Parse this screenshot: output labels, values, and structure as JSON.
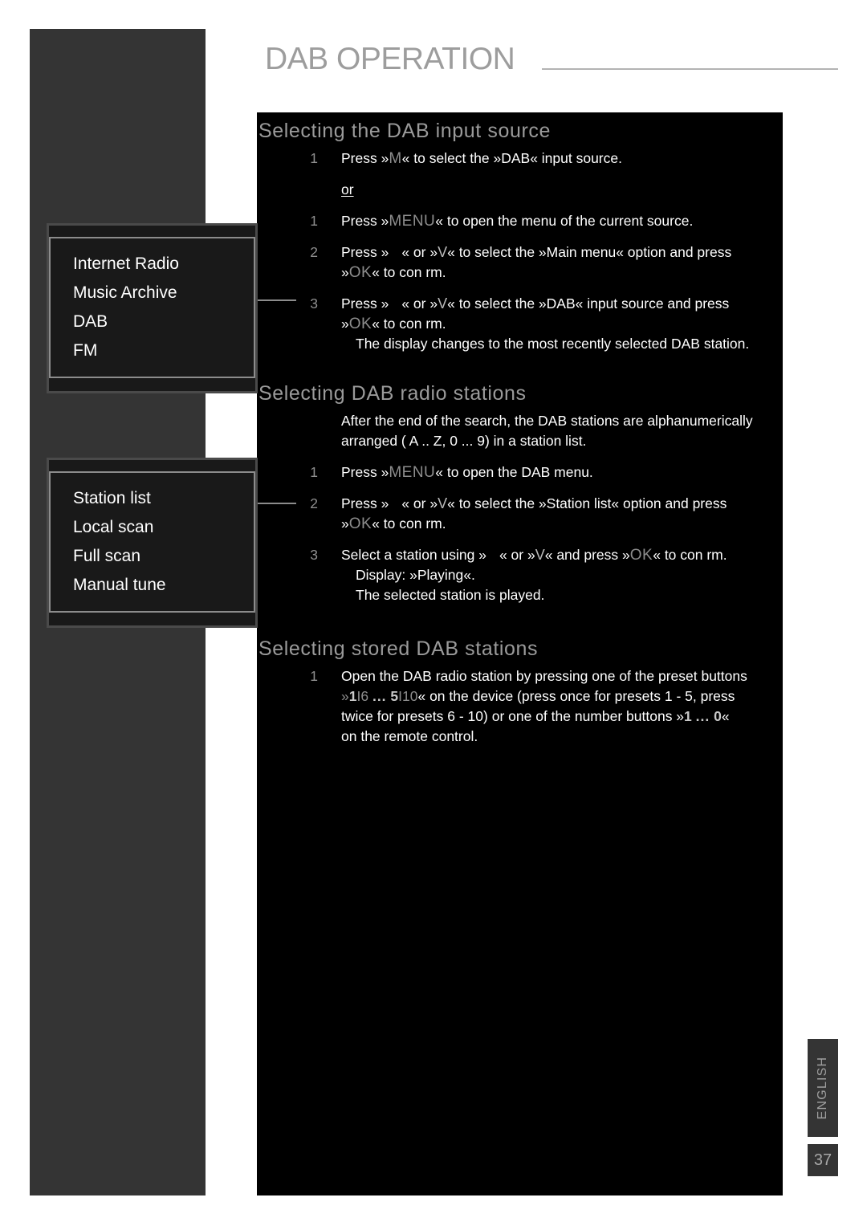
{
  "header": {
    "title": "DAB OPERATION"
  },
  "sections": [
    {
      "id": "selecting-dab-input-source",
      "title": "Selecting the DAB input source",
      "steps": [
        {
          "num": "1",
          "line1_a": "Press »",
          "key": "M",
          "line1_b": "« to select the »DAB« input source."
        }
      ],
      "or_label": "or",
      "steps2": [
        {
          "num": "1",
          "line1_a": "Press »",
          "key": "MENU",
          "line1_b": "« to open the menu of the current source."
        },
        {
          "num": "2",
          "a": "Press »",
          "b": "« or »",
          "arrow": "V",
          "c": "« to select the »Main menu« option and press",
          "d_pre": "»",
          "d_key": "OK",
          "d_post": "« to con rm."
        },
        {
          "num": "3",
          "a": "Press »",
          "b": "« or »",
          "arrow": "V",
          "c": "« to select the »DAB« input source and press",
          "d_pre": "»",
          "d_key": "OK",
          "d_post": "« to con rm.",
          "note": "The display changes to the most recently selected DAB station."
        }
      ]
    },
    {
      "id": "selecting-dab-radio-stations",
      "title": "Selecting DAB radio stations",
      "intro_line1": "After the end of the search, the DAB stations are alphanumerically",
      "intro_line2": "arranged ( A .. Z, 0 ... 9) in a station list.",
      "steps": [
        {
          "num": "1",
          "line1_a": "Press »",
          "key": "MENU",
          "line1_b": "« to open the DAB menu."
        },
        {
          "num": "2",
          "a": "Press »",
          "b": "« or »",
          "arrow": "V",
          "c": "« to select the »Station list« option and press",
          "d_pre": "»",
          "d_key": "OK",
          "d_post": "« to con rm."
        },
        {
          "num": "3",
          "a": "Select a station using »",
          "b": "« or »",
          "arrow": "V",
          "c": "« and press »",
          "d_key": "OK",
          "d_post": "« to con rm.",
          "note1": "Display: »Playing«.",
          "note2": "The selected station is played."
        }
      ]
    },
    {
      "id": "selecting-stored-dab-stations",
      "title": "Selecting stored DAB stations",
      "steps": [
        {
          "num": "1",
          "line1": "Open the DAB radio station by pressing one of the preset buttons",
          "line2_pre": "»",
          "line2_k1": "1",
          "line2_k1b": "I6",
          "line2_ell": "...",
          "line2_k2": "5",
          "line2_k2b": "I10",
          "line2_post": "« on the device (press once for presets 1 - 5, press",
          "line3_pre": "twice for presets 6 - 10) or one of the number buttons »",
          "line3_k1": "1",
          "line3_ell": "...",
          "line3_k2": "0",
          "line3_post": "«",
          "line4": "on the remote control."
        }
      ]
    }
  ],
  "menu_boxes": {
    "source_menu": {
      "items": [
        "Internet Radio",
        "Music Archive",
        "DAB",
        "FM"
      ]
    },
    "dab_menu": {
      "items": [
        "Station list",
        "Local scan",
        "Full scan",
        "Manual tune"
      ]
    }
  },
  "footer": {
    "language_tab": "ENGLISH",
    "page_number": "37"
  },
  "colors": {
    "panel_background": "#000000",
    "sidebar_background": "#343434",
    "heading_gray": "#9a9a9a",
    "key_gray": "#8d8d8d",
    "body_white": "#ffffff",
    "menu_box_background": "#191919",
    "menu_box_border": "#8c8c8c"
  }
}
